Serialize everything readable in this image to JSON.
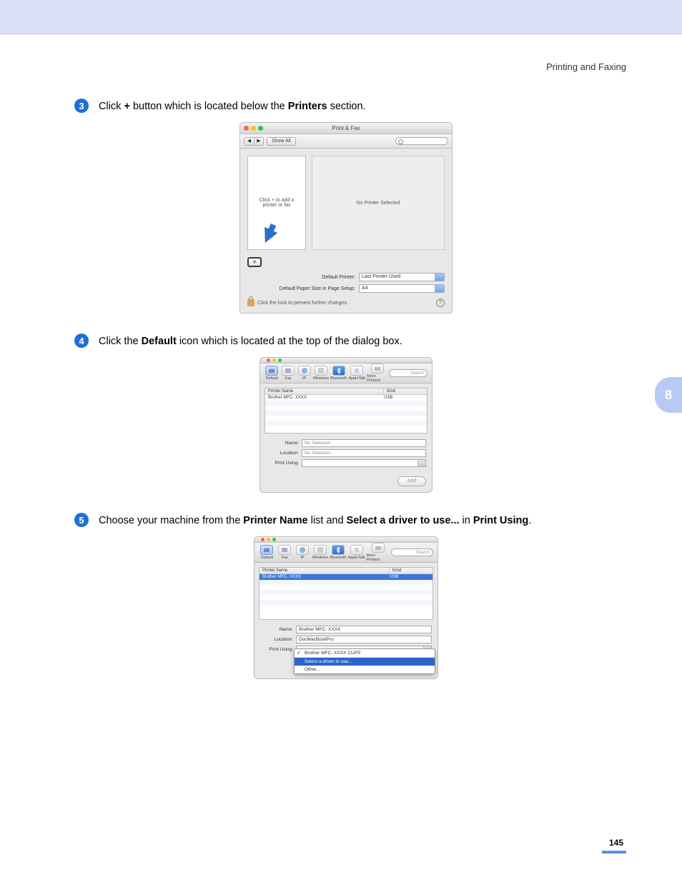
{
  "header": {
    "section": "Printing and Faxing"
  },
  "side_tab": "8",
  "page_number": "145",
  "steps": {
    "s3": {
      "num": "3",
      "pre": "Click ",
      "b1": "+",
      "mid": " button which is located below the ",
      "b2": "Printers",
      "post": " section."
    },
    "s4": {
      "num": "4",
      "pre": "Click the ",
      "b1": "Default",
      "post": " icon which is located at the top of the dialog box."
    },
    "s5": {
      "num": "5",
      "pre": "Choose your machine from the ",
      "b1": "Printer Name",
      "mid": " list and ",
      "b2": "Select a driver to use...",
      "mid2": " in ",
      "b3": "Print Using",
      "post": "."
    }
  },
  "fig1": {
    "title": "Print & Fax",
    "show_all": "Show All",
    "nav_back": "◀",
    "nav_fwd": "▶",
    "list_placeholder": "Click + to add a\nprinter or fax",
    "detail_placeholder": "No Printer Selected",
    "plus": "+",
    "default_printer_label": "Default Printer:",
    "default_printer_value": "Last Printer Used",
    "paper_label": "Default Paper Size in Page Setup:",
    "paper_value": "A4",
    "lock_text": "Click the lock to prevent further changes.",
    "help": "?"
  },
  "fig2": {
    "toolbar": {
      "default": "Default",
      "fax": "Fax",
      "ip": "IP",
      "windows": "Windows",
      "bluetooth": "Bluetooth",
      "appletalk": "AppleTalk",
      "more": "More Printers"
    },
    "search_placeholder": "Search",
    "hdr_name": "Printer Name",
    "hdr_kind": "Kind",
    "row_name": "Brother MFC- XXXX",
    "row_kind": "USB",
    "name_label": "Name:",
    "name_value": "No Selection",
    "location_label": "Location:",
    "location_value": "No Selection",
    "printusing_label": "Print Using:",
    "printusing_value": "",
    "add_btn": "Add"
  },
  "fig3": {
    "row_name": "Brother MFC- XXXX",
    "row_kind": "USB",
    "name_value": "Brother MFC- XXXX",
    "location_value": "DocMacBookPro",
    "printusing_label": "Print Using:",
    "drop_checked": "Brother MFC- XXXX CUPS",
    "drop_hl": "Select a driver to use...",
    "drop_other": "Other..."
  }
}
